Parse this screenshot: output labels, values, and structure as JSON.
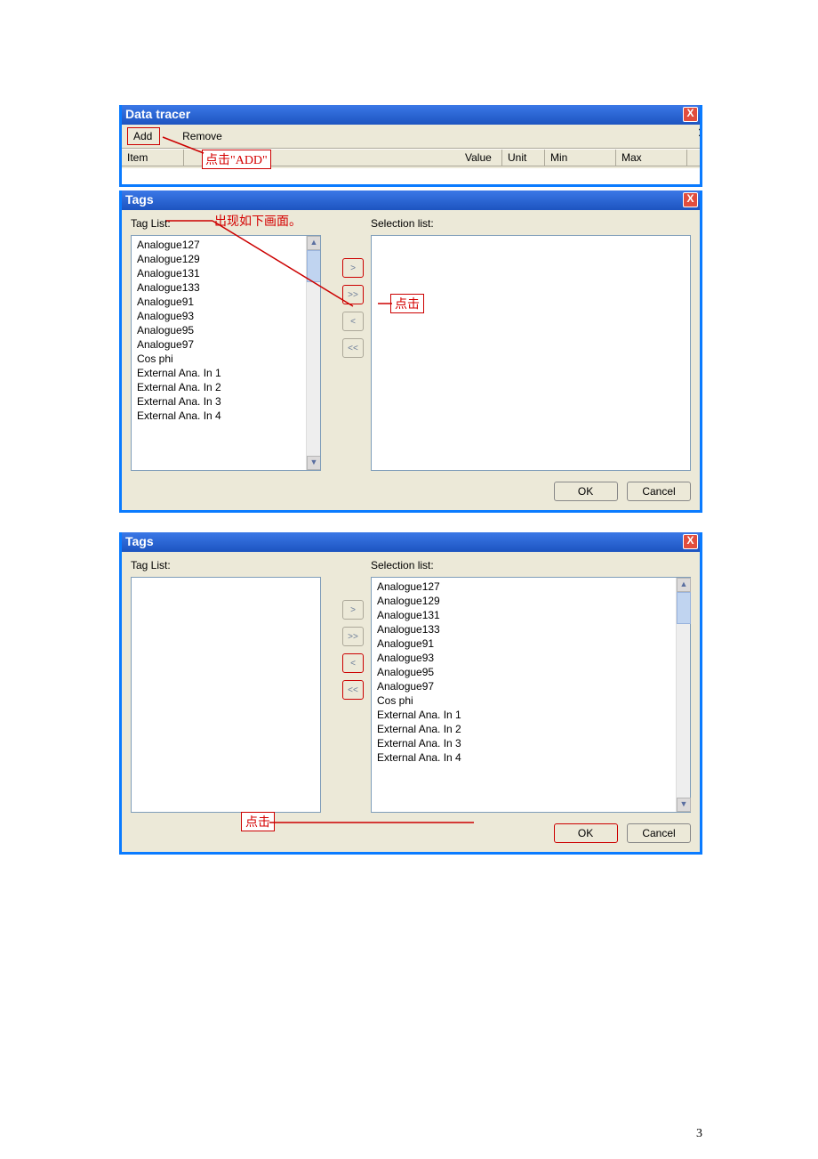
{
  "data_tracer": {
    "title": "Data tracer",
    "add_btn": "Add",
    "remove_btn": "Remove",
    "grid_headers": {
      "item": "Item",
      "value": "Value",
      "unit": "Unit",
      "min": "Min",
      "max": "Max"
    },
    "annot_add": "点击\"ADD\""
  },
  "tags1": {
    "title": "Tags",
    "tag_list_label": "Tag List:",
    "selection_list_label": "Selection list:",
    "tag_items": [
      "Analogue127",
      "Analogue129",
      "Analogue131",
      "Analogue133",
      "Analogue91",
      "Analogue93",
      "Analogue95",
      "Analogue97",
      "Cos phi",
      "External Ana. In 1",
      "External Ana. In 2",
      "External Ana. In 3",
      "External Ana. In 4"
    ],
    "ok_btn": "OK",
    "cancel_btn": "Cancel",
    "annot_panel": "出现如下画面。",
    "annot_click": "点击"
  },
  "tags2": {
    "title": "Tags",
    "tag_list_label": "Tag List:",
    "selection_list_label": "Selection list:",
    "sel_items": [
      "Analogue127",
      "Analogue129",
      "Analogue131",
      "Analogue133",
      "Analogue91",
      "Analogue93",
      "Analogue95",
      "Analogue97",
      "Cos phi",
      "External Ana. In 1",
      "External Ana. In 2",
      "External Ana. In 3",
      "External Ana. In 4"
    ],
    "ok_btn": "OK",
    "cancel_btn": "Cancel",
    "annot_click": "点击"
  },
  "page_number": "3",
  "glyphs": {
    "gt": ">",
    "gg": ">>",
    "lt": "<",
    "ll": "<<",
    "close": "X"
  }
}
